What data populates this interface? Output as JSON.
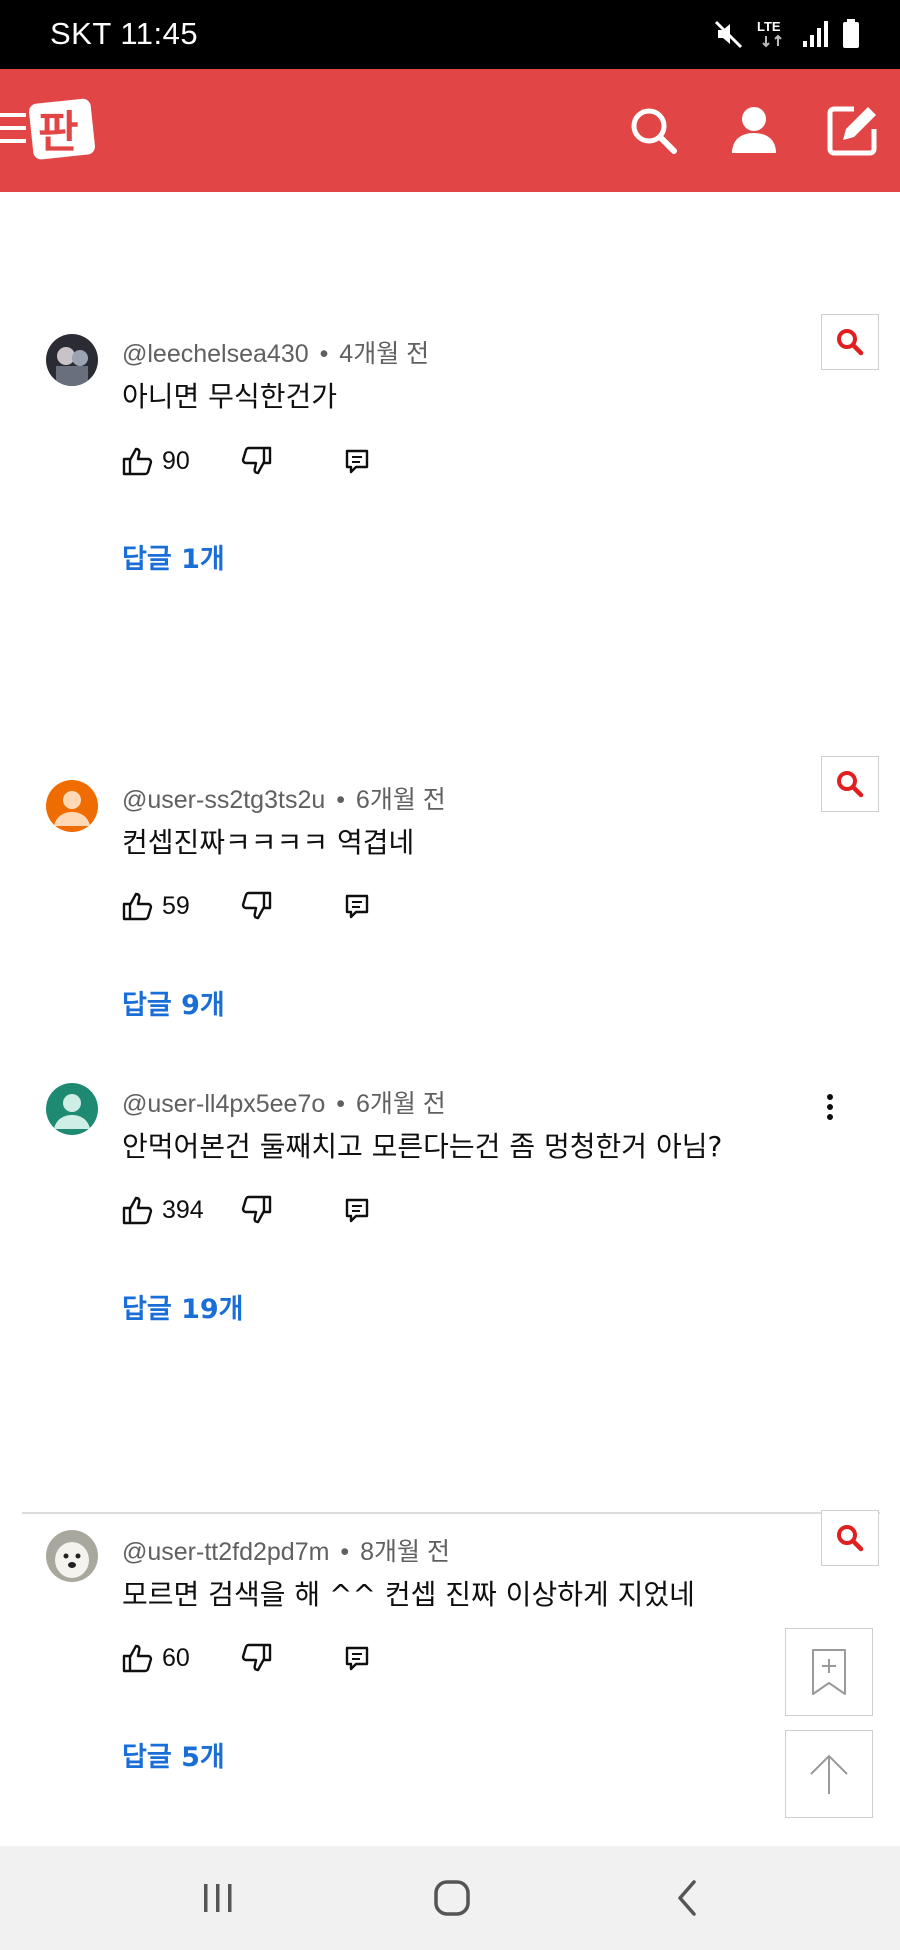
{
  "status_bar": {
    "carrier_time": "SKT 11:45",
    "network": "LTE",
    "icons": [
      "mute-icon",
      "lte-icon",
      "signal-icon",
      "battery-icon"
    ]
  },
  "header": {
    "logo_text": "판",
    "brand_color": "#e24545",
    "icons": [
      "menu-icon",
      "search-icon",
      "user-icon",
      "write-icon"
    ]
  },
  "comments": [
    {
      "author": "@leechelsea430",
      "time": "4개월 전",
      "text": "아니면 무식한건가",
      "likes": "90",
      "replies": "답글 1개",
      "avatar": "photo"
    },
    {
      "author": "@user-ss2tg3ts2u",
      "time": "6개월 전",
      "text": "컨셉진짜ㅋㅋㅋㅋ 역겹네",
      "likes": "59",
      "replies": "답글 9개",
      "avatar": "orange-default"
    },
    {
      "author": "@user-ll4px5ee7o",
      "time": "6개월 전",
      "text": "안먹어본건 둘째치고 모른다는건 좀 멍청한거 아님?",
      "likes": "394",
      "replies": "답글 19개",
      "avatar": "teal-default"
    },
    {
      "author": "@user-tt2fd2pd7m",
      "time": "8개월 전",
      "text": "모르면 검색을 해 ^^ 컨셉 진짜 이상하게 지었네",
      "likes": "60",
      "replies": "답글 5개",
      "avatar": "dog-photo"
    }
  ],
  "meta_separator": "•",
  "colors": {
    "reply_link": "#1a6ed8",
    "meta_text": "#606060",
    "search_icon": "#e02020"
  },
  "floating_buttons": [
    "bookmark-add-icon",
    "arrow-up-icon"
  ],
  "nav_bar": [
    "recent-apps-icon",
    "home-icon",
    "back-icon"
  ]
}
